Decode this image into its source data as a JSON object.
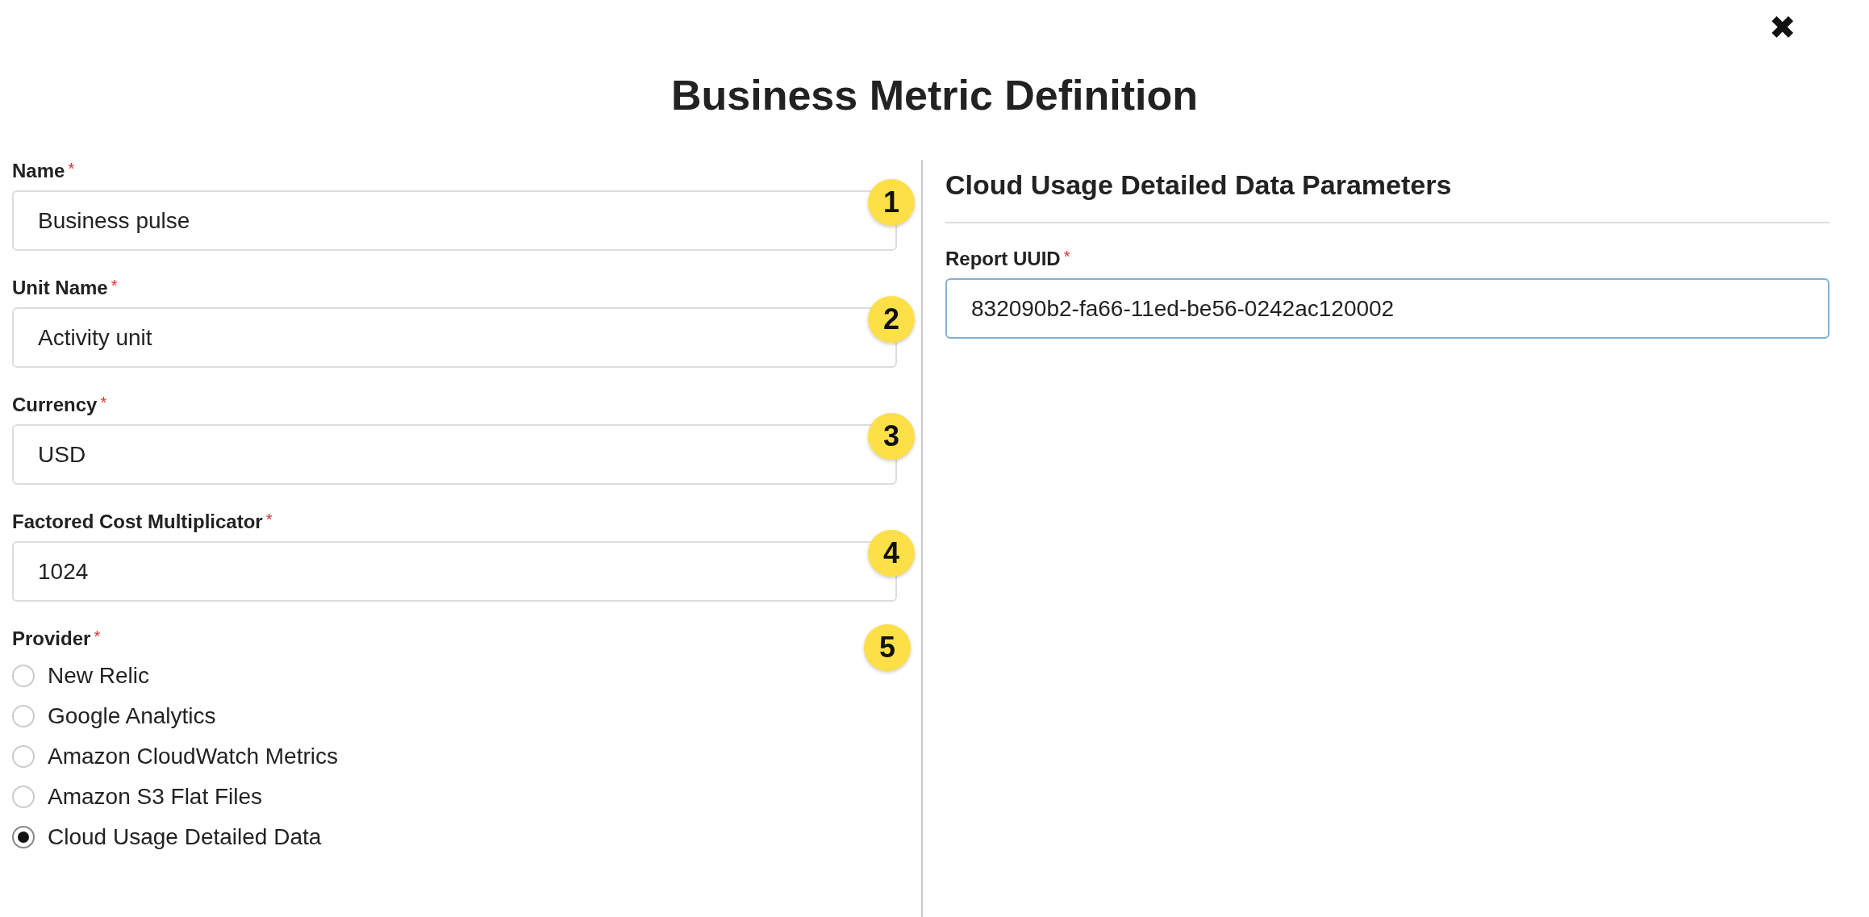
{
  "dialog": {
    "title": "Business Metric Definition",
    "close": "✖"
  },
  "fields": [
    {
      "label": "Name",
      "required_mark": "*",
      "value": "Business pulse",
      "badge": "1"
    },
    {
      "label": "Unit Name",
      "required_mark": "*",
      "value": "Activity unit",
      "badge": "2"
    },
    {
      "label": "Currency",
      "required_mark": "*",
      "value": "USD",
      "badge": "3"
    },
    {
      "label": "Factored Cost Multiplicator",
      "required_mark": "*",
      "value": "1024",
      "badge": "4"
    }
  ],
  "provider": {
    "label": "Provider",
    "required_mark": "*",
    "badge": "5",
    "options": [
      {
        "label": "New Relic",
        "selected": false
      },
      {
        "label": "Google Analytics",
        "selected": false
      },
      {
        "label": "Amazon CloudWatch Metrics",
        "selected": false
      },
      {
        "label": "Amazon S3 Flat Files",
        "selected": false
      },
      {
        "label": "Cloud Usage Detailed Data",
        "selected": true
      }
    ]
  },
  "parameters": {
    "title": "Cloud Usage Detailed Data Parameters",
    "fields": [
      {
        "label": "Report UUID",
        "required_mark": "*",
        "value": "832090b2-fa66-11ed-be56-0242ac120002",
        "focused": true
      }
    ]
  }
}
